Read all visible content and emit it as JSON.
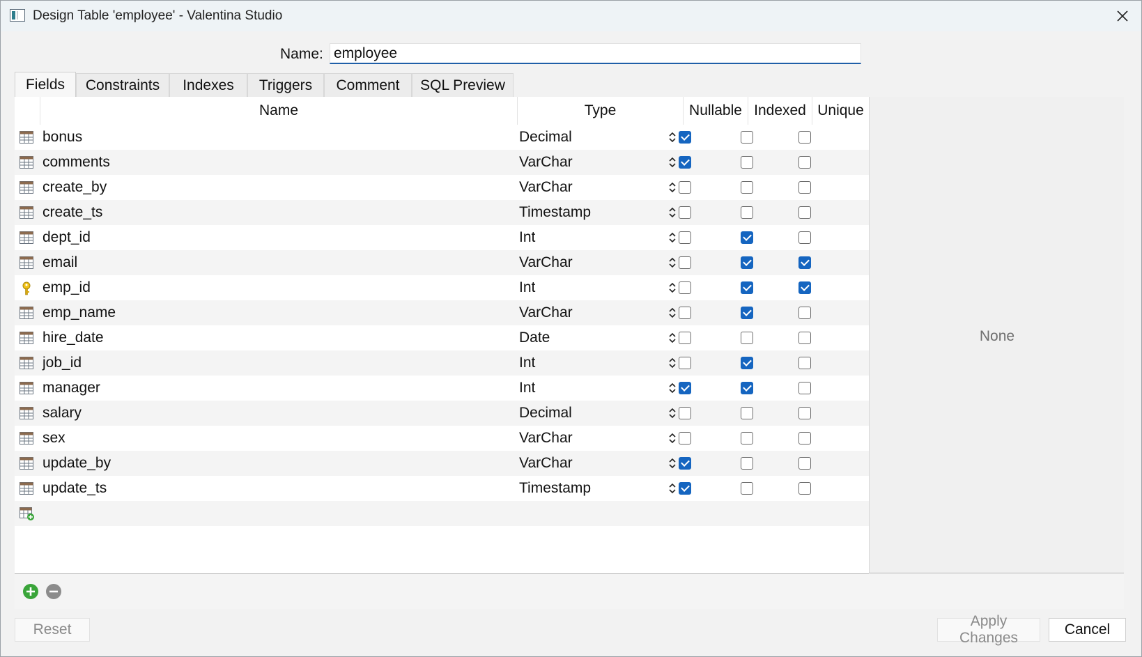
{
  "window": {
    "title": "Design Table 'employee' - Valentina Studio"
  },
  "name_field": {
    "label": "Name:",
    "value": "employee"
  },
  "tabs": [
    {
      "label": "Fields",
      "active": true
    },
    {
      "label": "Constraints",
      "active": false
    },
    {
      "label": "Indexes",
      "active": false
    },
    {
      "label": "Triggers",
      "active": false
    },
    {
      "label": "Comment",
      "active": false
    },
    {
      "label": "SQL Preview",
      "active": false
    }
  ],
  "columns": {
    "name": "Name",
    "type": "Type",
    "nullable": "Nullable",
    "indexed": "Indexed",
    "unique": "Unique"
  },
  "fields": [
    {
      "name": "bonus",
      "type": "Decimal",
      "nullable": true,
      "indexed": false,
      "unique": false,
      "icon": "table-field-icon"
    },
    {
      "name": "comments",
      "type": "VarChar",
      "nullable": true,
      "indexed": false,
      "unique": false,
      "icon": "table-field-icon"
    },
    {
      "name": "create_by",
      "type": "VarChar",
      "nullable": false,
      "indexed": false,
      "unique": false,
      "icon": "table-field-icon"
    },
    {
      "name": "create_ts",
      "type": "Timestamp",
      "nullable": false,
      "indexed": false,
      "unique": false,
      "icon": "table-field-icon"
    },
    {
      "name": "dept_id",
      "type": "Int",
      "nullable": false,
      "indexed": true,
      "unique": false,
      "icon": "table-field-icon"
    },
    {
      "name": "email",
      "type": "VarChar",
      "nullable": false,
      "indexed": true,
      "unique": true,
      "icon": "table-field-icon"
    },
    {
      "name": "emp_id",
      "type": "Int",
      "nullable": false,
      "indexed": true,
      "unique": true,
      "icon": "key-icon"
    },
    {
      "name": "emp_name",
      "type": "VarChar",
      "nullable": false,
      "indexed": true,
      "unique": false,
      "icon": "table-field-icon"
    },
    {
      "name": "hire_date",
      "type": "Date",
      "nullable": false,
      "indexed": false,
      "unique": false,
      "icon": "table-field-icon"
    },
    {
      "name": "job_id",
      "type": "Int",
      "nullable": false,
      "indexed": true,
      "unique": false,
      "icon": "table-field-icon"
    },
    {
      "name": "manager",
      "type": "Int",
      "nullable": true,
      "indexed": true,
      "unique": false,
      "icon": "table-field-icon"
    },
    {
      "name": "salary",
      "type": "Decimal",
      "nullable": false,
      "indexed": false,
      "unique": false,
      "icon": "table-field-icon"
    },
    {
      "name": "sex",
      "type": "VarChar",
      "nullable": false,
      "indexed": false,
      "unique": false,
      "icon": "table-field-icon"
    },
    {
      "name": "update_by",
      "type": "VarChar",
      "nullable": true,
      "indexed": false,
      "unique": false,
      "icon": "table-field-icon"
    },
    {
      "name": "update_ts",
      "type": "Timestamp",
      "nullable": true,
      "indexed": false,
      "unique": false,
      "icon": "table-field-icon"
    }
  ],
  "properties_panel": {
    "text": "None"
  },
  "buttons": {
    "reset": "Reset",
    "apply": "Apply Changes",
    "cancel": "Cancel"
  },
  "colors": {
    "accent": "#1565c0",
    "add": "#3aa53a",
    "remove": "#8c8c8c"
  }
}
